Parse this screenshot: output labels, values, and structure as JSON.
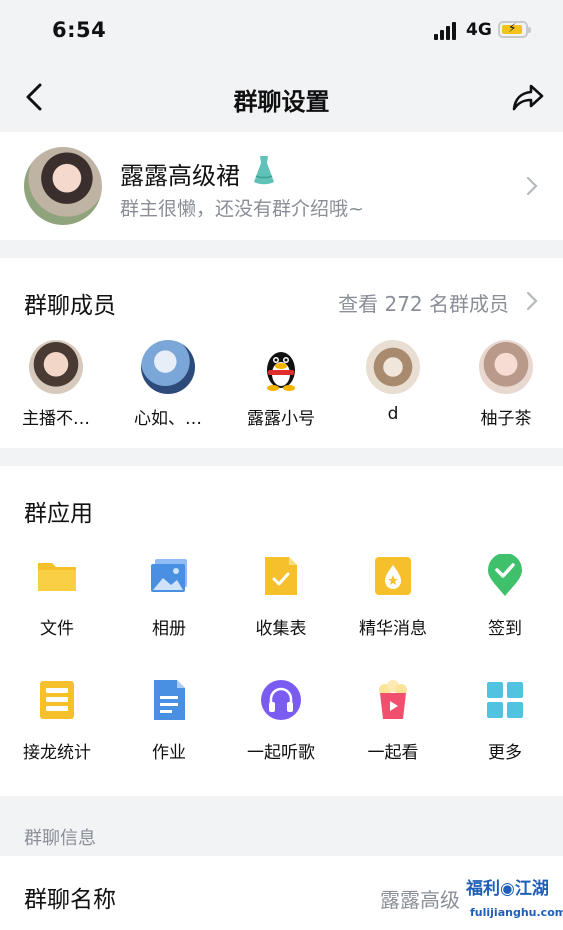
{
  "status_bar": {
    "time": "6:54",
    "network": "4G"
  },
  "navbar": {
    "title": "群聊设置",
    "back_icon": "chevron-left-icon",
    "share_icon": "share-icon"
  },
  "group": {
    "name": "露露高级裙",
    "intro": "群主很懒，还没有群介绍哦~"
  },
  "members": {
    "title": "群聊成员",
    "view_all": "查看 272 名群成员",
    "list": [
      {
        "name": "主播不…"
      },
      {
        "name": "心如、…"
      },
      {
        "name": "露露小号"
      },
      {
        "name": "d"
      },
      {
        "name": "柚子茶"
      }
    ]
  },
  "apps": {
    "title": "群应用",
    "items": [
      {
        "label": "文件",
        "icon": "folder-icon"
      },
      {
        "label": "相册",
        "icon": "album-icon"
      },
      {
        "label": "收集表",
        "icon": "form-icon"
      },
      {
        "label": "精华消息",
        "icon": "essence-icon"
      },
      {
        "label": "签到",
        "icon": "checkin-icon"
      },
      {
        "label": "接龙统计",
        "icon": "chain-icon"
      },
      {
        "label": "作业",
        "icon": "homework-icon"
      },
      {
        "label": "一起听歌",
        "icon": "headphones-icon"
      },
      {
        "label": "一起看",
        "icon": "popcorn-icon"
      },
      {
        "label": "更多",
        "icon": "grid-icon"
      }
    ]
  },
  "info": {
    "section_label": "群聊信息",
    "name_label": "群聊名称",
    "name_value": "露露高级"
  },
  "watermark": {
    "text": "福利江湖",
    "sub": "fulijianghu.com"
  },
  "colors": {
    "accent_blue": "#4a90e2",
    "yellow": "#f5c02c",
    "green": "#3fc06a",
    "purple": "#7b5cf0"
  }
}
